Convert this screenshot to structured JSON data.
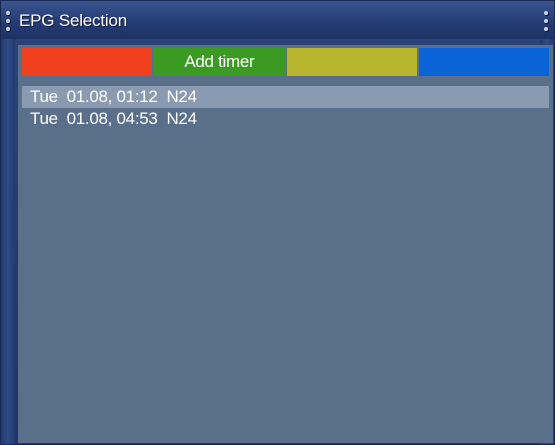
{
  "window": {
    "title": "EPG Selection"
  },
  "colors": {
    "red": "#f0401e",
    "green": "#3a9a22",
    "yellow": "#b8b52e",
    "blue": "#0a64d8",
    "panel": "#5a6f8a",
    "selection": "#8a9ab0",
    "frame": "#2d4478"
  },
  "buttons": [
    {
      "key": "red",
      "label": ""
    },
    {
      "key": "green",
      "label": "Add timer"
    },
    {
      "key": "yellow",
      "label": ""
    },
    {
      "key": "blue",
      "label": ""
    }
  ],
  "list": {
    "selected_index": 0,
    "items": [
      {
        "day": "Tue",
        "date": "01.08,",
        "time": "01:12",
        "channel": "N24"
      },
      {
        "day": "Tue",
        "date": "01.08,",
        "time": "04:53",
        "channel": "N24"
      }
    ]
  }
}
